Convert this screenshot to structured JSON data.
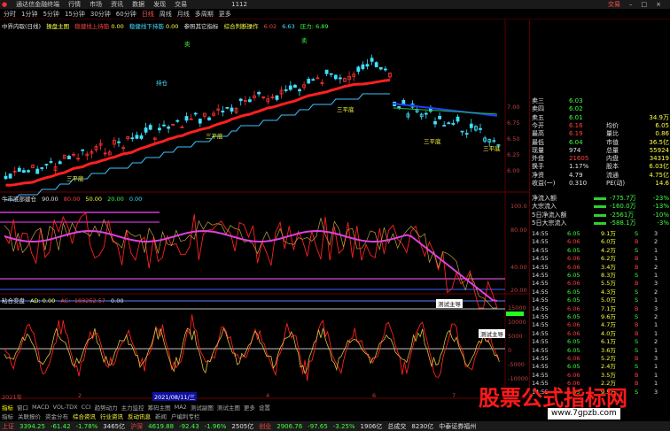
{
  "titlebar": {
    "app": "通达信金融终端",
    "menus": [
      "行情",
      "市场",
      "资讯",
      "数据",
      "发现",
      "交易"
    ],
    "code": "1112",
    "right": "交易"
  },
  "toolbar": {
    "periods": [
      "分时",
      "1分钟",
      "5分钟",
      "15分钟",
      "30分钟",
      "60分钟",
      "日线",
      "周线",
      "月线",
      "多周期",
      "更多"
    ],
    "active": "日线"
  },
  "main_pane": {
    "title": "中界内取(日线)",
    "indicator": "操盘主图",
    "legend1": "稳健线上持筋",
    "legend2": "稳健线下持筋",
    "legend3": "参照其它指标",
    "legend4": "综合判断操作",
    "legend5": "压力:",
    "val_a": "0.00",
    "val_b": "0.00",
    "val_c": "6.02",
    "val_d": "6.63",
    "val_e": "6.89",
    "y_ticks": [
      "7.00",
      "6.75",
      "6.50",
      "6.25",
      "6.00"
    ],
    "labels_buy": [
      "三平底",
      "三平底",
      "三平底",
      "三平底",
      "三平底"
    ],
    "labels_sell": [
      "卖",
      "卖"
    ],
    "label_hold": "持仓"
  },
  "sub1": {
    "title": "牛市底部建仓",
    "vals": [
      "90.00",
      "80.00",
      "50.00",
      "20.00",
      "0.00"
    ],
    "y_ticks": [
      "100.0",
      "80.00",
      "40.00",
      "20.00"
    ]
  },
  "sub2": {
    "title": "粘合变盘",
    "ad_label": "AD: 0.00",
    "ac_label": "AC: -183252.57",
    "extra": "0.00",
    "y_ticks": [
      "15000",
      "10000",
      "5000",
      "0",
      "-5000",
      "-10000"
    ],
    "btn": "测试主导"
  },
  "x_axis": {
    "dates": [
      "2021年",
      "2",
      "3",
      "4",
      "5",
      "6",
      "7"
    ],
    "current": "2021/08/11/三"
  },
  "quote": {
    "rows": [
      {
        "l": "卖三",
        "v": "6.03",
        "r1": "",
        "r2": "",
        "c": "grn"
      },
      {
        "l": "卖四",
        "v": "6.02",
        "r1": "",
        "r2": "",
        "c": "grn"
      },
      {
        "l": "卖五",
        "v": "6.01",
        "r1": "",
        "r2": "34.9万",
        "c": "grn"
      },
      {
        "l": "今开",
        "v": "6.16",
        "r1": "均价",
        "r2": "6.05",
        "c": "red"
      },
      {
        "l": "最高",
        "v": "6.19",
        "r1": "量比",
        "r2": "0.86",
        "c": "red"
      },
      {
        "l": "最低",
        "v": "6.04",
        "r1": "市值",
        "r2": "36.5亿",
        "c": "grn"
      },
      {
        "l": "现量",
        "v": "974",
        "r1": "总量",
        "r2": "55924",
        "c": "wht"
      },
      {
        "l": "外盘",
        "v": "21605",
        "r1": "内盘",
        "r2": "34319",
        "c": "red"
      },
      {
        "l": "换手",
        "v": "1.17%",
        "r1": "股本",
        "r2": "6.03亿",
        "c": "wht"
      },
      {
        "l": "净资",
        "v": "4.79",
        "r1": "流通",
        "r2": "4.75亿",
        "c": "wht"
      },
      {
        "l": "收益(一)",
        "v": "0.310",
        "r1": "PE(动)",
        "r2": "14.6",
        "c": "wht"
      }
    ],
    "flow": [
      {
        "l": "净流入额",
        "v": "-775.7万",
        "p": "-23%"
      },
      {
        "l": "大宗流入",
        "v": "-160.0万",
        "p": "-13%"
      },
      {
        "l": "5日净流入额",
        "v": "-2561万",
        "p": "-10%"
      },
      {
        "l": "5日大宗流入",
        "v": "-588.1万",
        "p": "-3%"
      }
    ],
    "ticks": [
      {
        "t": "14:55",
        "p": "6.05",
        "v": "9.1万",
        "d": "S",
        "n": "3"
      },
      {
        "t": "14:55",
        "p": "6.06",
        "v": "6.0万",
        "d": "B",
        "n": "2"
      },
      {
        "t": "14:55",
        "p": "6.05",
        "v": "4.2万",
        "d": "S",
        "n": "1"
      },
      {
        "t": "14:55",
        "p": "6.06",
        "v": "6.2万",
        "d": "B",
        "n": "1"
      },
      {
        "t": "14:55",
        "p": "6.06",
        "v": "3.4万",
        "d": "B",
        "n": "2"
      },
      {
        "t": "14:55",
        "p": "6.05",
        "v": "8.3万",
        "d": "S",
        "n": "1"
      },
      {
        "t": "14:55",
        "p": "6.06",
        "v": "5.5万",
        "d": "B",
        "n": "3"
      },
      {
        "t": "14:55",
        "p": "6.05",
        "v": "4.3万",
        "d": "S",
        "n": "2"
      },
      {
        "t": "14:55",
        "p": "6.05",
        "v": "5.0万",
        "d": "S",
        "n": "1"
      },
      {
        "t": "14:55",
        "p": "6.06",
        "v": "7.1万",
        "d": "B",
        "n": "3"
      },
      {
        "t": "14:55",
        "p": "6.05",
        "v": "9.6万",
        "d": "S",
        "n": "2"
      },
      {
        "t": "14:55",
        "p": "6.06",
        "v": "4.7万",
        "d": "B",
        "n": "1"
      },
      {
        "t": "14:55",
        "p": "6.06",
        "v": "4.0万",
        "d": "B",
        "n": "1"
      },
      {
        "t": "14:55",
        "p": "6.05",
        "v": "6.1万",
        "d": "S",
        "n": "2"
      },
      {
        "t": "14:55",
        "p": "6.05",
        "v": "3.6万",
        "d": "S",
        "n": "1"
      },
      {
        "t": "14:55",
        "p": "6.06",
        "v": "5.2万",
        "d": "B",
        "n": "3"
      },
      {
        "t": "14:55",
        "p": "6.05",
        "v": "2.4万",
        "d": "S",
        "n": "1"
      },
      {
        "t": "14:55",
        "p": "6.06",
        "v": "3.5万",
        "d": "B",
        "n": "1"
      },
      {
        "t": "14:55",
        "p": "6.06",
        "v": "2.2万",
        "d": "B",
        "n": "1"
      },
      {
        "t": "14:55",
        "p": "6.05",
        "v": "9.5万",
        "d": "S",
        "n": "3"
      }
    ]
  },
  "bottomtabs": {
    "row1": [
      "指标",
      "窗口",
      "MACD",
      "VOL-TDX",
      "CCI",
      "趋势动力",
      "主力监控",
      "筹码主图",
      "MA2",
      "测试副图",
      "测试主图",
      "更多",
      "设置"
    ],
    "row2": [
      "指标",
      "关联报价",
      "资金分布",
      "综合资讯",
      "行业资讯",
      "反动讯息",
      "新闻",
      "户编利专栏"
    ]
  },
  "status": {
    "sh": "上证",
    "sh_v": "3394.25",
    "sh_c": "-61.42",
    "sh_p": "-1.78%",
    "sh_a": "3465亿",
    "hs": "沪深",
    "hs_v": "4619.88",
    "hs_c": "-92.43",
    "hs_p": "-1.96%",
    "hs_a": "2505亿",
    "cy": "创业",
    "cy_v": "2906.76",
    "cy_c": "-97.65",
    "cy_p": "-3.25%",
    "cy_a": "1906亿",
    "total": "总成交",
    "total_v": "8230亿",
    "broker": "中泰证券福州"
  },
  "watermark": "股票公式指标网",
  "url": "www.7gpzb.com"
}
